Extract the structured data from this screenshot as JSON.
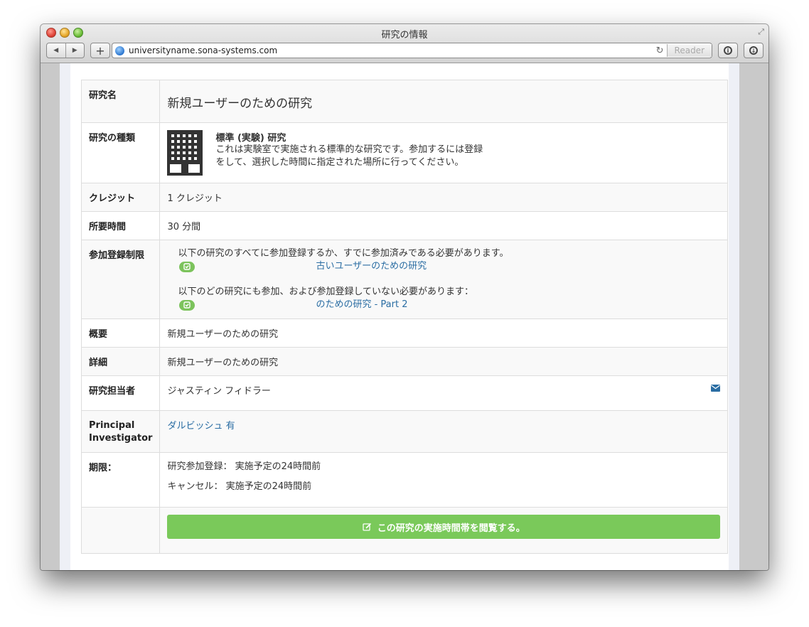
{
  "window": {
    "title": "研究の情報",
    "url": "universityname.sona-systems.com",
    "reader_label": "Reader"
  },
  "rows": {
    "name": {
      "label": "研究名",
      "value": "新規ユーザーのための研究"
    },
    "type": {
      "label": "研究の種類",
      "heading": "標準 (実験) 研究",
      "description": "これは実験室で実施される標準的な研究です。参加するには登録をして、選択した時間に指定された場所に行ってください。"
    },
    "credits": {
      "label": "クレジット",
      "value": "1 クレジット"
    },
    "duration": {
      "label": "所要時間",
      "value": "30 分間"
    },
    "restrictions": {
      "label": "参加登録制限",
      "required_text": "以下の研究のすべてに参加登録するか、すでに参加済みである必要があります。",
      "required_study": "古いユーザーのための研究",
      "excluded_text": "以下のどの研究にも参加、および参加登録していない必要があります：",
      "excluded_study": "のための研究 - Part 2"
    },
    "summary": {
      "label": "概要",
      "value": "新規ユーザーのための研究"
    },
    "details": {
      "label": "詳細",
      "value": "新規ユーザーのための研究"
    },
    "researcher": {
      "label": "研究担当者",
      "value": "ジャスティン フィドラー"
    },
    "pi": {
      "label": "Principal Investigator",
      "value": "ダルビッシュ 有"
    },
    "deadlines": {
      "label": "期限：",
      "signup": "研究参加登録：  実施予定の24時間前",
      "cancel": "キャンセル：  実施予定の24時間前"
    }
  },
  "cta_label": "この研究の実施時間帯を閲覧する。",
  "colors": {
    "accent_green": "#7ac95a",
    "link_blue": "#2a6da3"
  }
}
